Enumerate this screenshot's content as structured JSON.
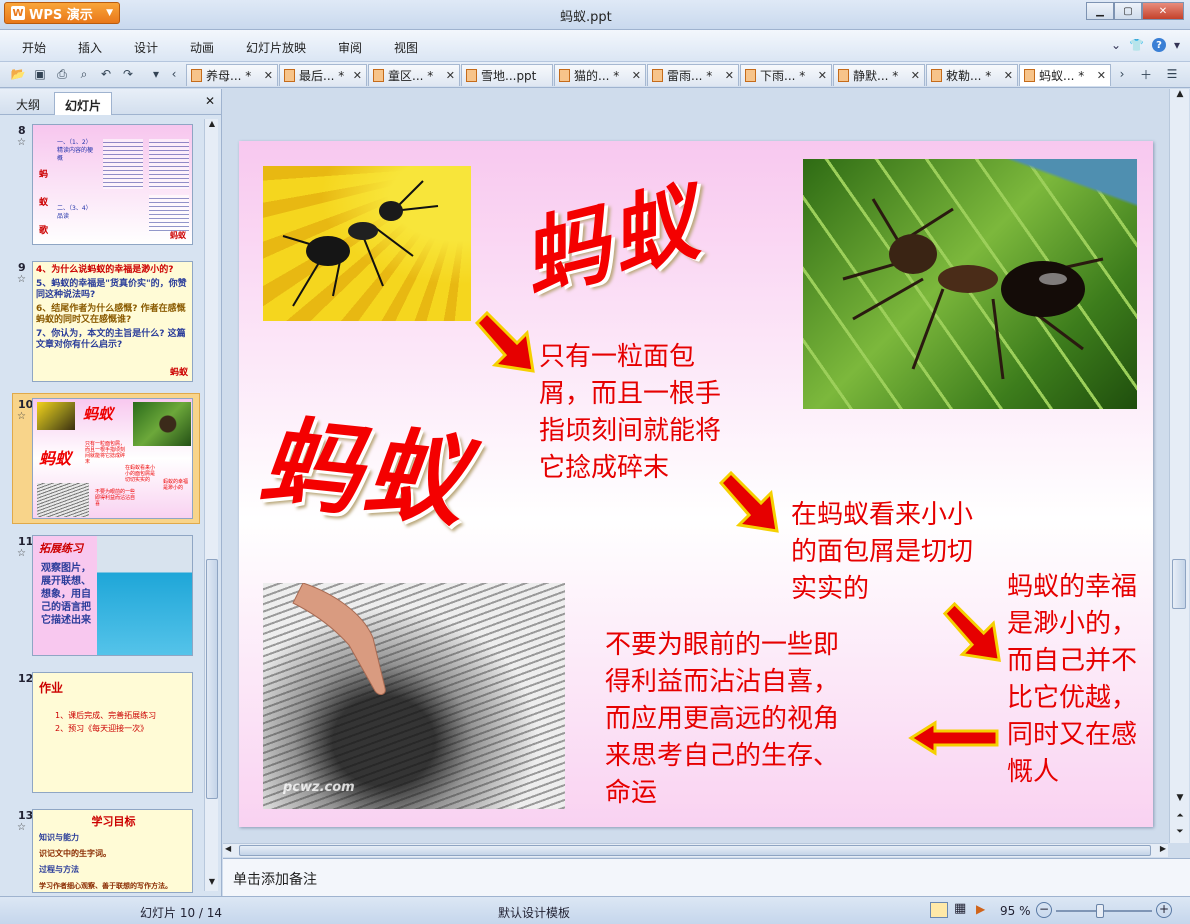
{
  "app": {
    "name": "WPS 演示",
    "window_title": "蚂蚁.ppt"
  },
  "menu": [
    "开始",
    "插入",
    "设计",
    "动画",
    "幻灯片放映",
    "审阅",
    "视图"
  ],
  "tabs": [
    {
      "label": "养母... *"
    },
    {
      "label": "最后... *"
    },
    {
      "label": "童区... *"
    },
    {
      "label": "雪地...ppt"
    },
    {
      "label": "猫的... *"
    },
    {
      "label": "雷雨... *"
    },
    {
      "label": "下雨... *"
    },
    {
      "label": "静默... *"
    },
    {
      "label": "敕勒... *"
    },
    {
      "label": "蚂蚁... *"
    }
  ],
  "left_pane": {
    "tab_outline": "大纲",
    "tab_slides": "幻灯片",
    "thumbnails": [
      {
        "num": "8",
        "lines": [
          "蚂",
          "蚁",
          "歌",
          "表",
          "一、（1、2）精读内容的梗概",
          "二、（3、4）品读"
        ],
        "tag": "蚂蚁"
      },
      {
        "num": "9",
        "lines": [
          "4、为什么说蚂蚁的幸福是渺小的?",
          "5、蚂蚁的幸福是\"货真价实\"的，你赞同这种说法吗?",
          "6、结尾作者为什么感慨? 作者在感慨蚂蚁的同时又在感慨谁?",
          "7、你认为，本文的主旨是什么? 这篇文章对你有什么启示?"
        ],
        "tag": "蚂蚁"
      },
      {
        "num": "10"
      },
      {
        "num": "11",
        "title": "拓展练习",
        "body": "观察图片，展开联想、想象，用自己的语言把它描述出来"
      },
      {
        "num": "12",
        "title": "作业",
        "items": [
          "1、课后完成、完善拓展练习",
          "2、预习《每天迎接一次》"
        ]
      },
      {
        "num": "13",
        "title": "学习目标",
        "items": [
          "知识与能力",
          "识记文中的生字词。",
          "过程与方法",
          "学习作者细心观察、善于联想的写作方法。"
        ]
      }
    ]
  },
  "slide": {
    "title_top": "蚂蚁",
    "title_left": "蚂蚁",
    "text1": "只有一粒面包屑，而且一根手指顷刻间就能将它捻成碎末",
    "text2": "在蚂蚁看来小小的面包屑是切切实实的",
    "text3": "蚂蚁的幸福是渺小的，而自己并不比它优越，同时又在感慨人",
    "text4": "不要为眼前的一些即得利益而沾沾自喜，而应用更高远的视角来思考自己的生存、命运",
    "watermark": "pcwz.com",
    "text_color": "#e60000"
  },
  "notes_placeholder": "单击添加备注",
  "status": {
    "slide_counter": "幻灯片 10 / 14",
    "template": "默认设计模板",
    "zoom": "95 %"
  }
}
